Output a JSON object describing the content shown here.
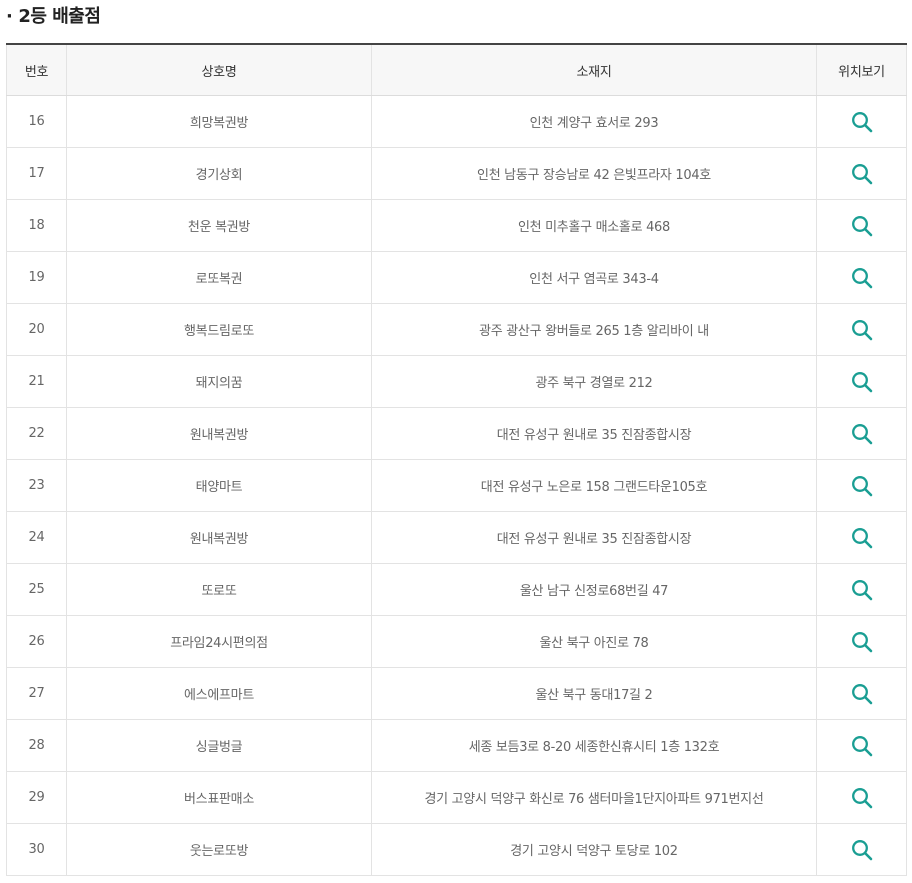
{
  "section": {
    "bullet": "·",
    "title": "2등 배출점"
  },
  "table": {
    "headers": {
      "no": "번호",
      "name": "상호명",
      "address": "소재지",
      "map": "위치보기"
    },
    "rows": [
      {
        "no": "16",
        "name": "희망복권방",
        "address": "인천 계양구 효서로 293"
      },
      {
        "no": "17",
        "name": "경기상회",
        "address": "인천 남동구 장승남로 42 은빛프라자 104호"
      },
      {
        "no": "18",
        "name": "천운 복권방",
        "address": "인천 미추홀구 매소홀로 468"
      },
      {
        "no": "19",
        "name": "로또복권",
        "address": "인천 서구 염곡로 343-4"
      },
      {
        "no": "20",
        "name": "행복드림로또",
        "address": "광주 광산구 왕버들로 265 1층 알리바이 내"
      },
      {
        "no": "21",
        "name": "돼지의꿈",
        "address": "광주 북구 경열로 212"
      },
      {
        "no": "22",
        "name": "원내복권방",
        "address": "대전 유성구 원내로 35 진잠종합시장"
      },
      {
        "no": "23",
        "name": "태양마트",
        "address": "대전 유성구 노은로 158 그랜드타운105호"
      },
      {
        "no": "24",
        "name": "원내복권방",
        "address": "대전 유성구 원내로 35 진잠종합시장"
      },
      {
        "no": "25",
        "name": "또로또",
        "address": "울산 남구 신정로68번길 47"
      },
      {
        "no": "26",
        "name": "프라임24시편의점",
        "address": "울산 북구 아진로 78"
      },
      {
        "no": "27",
        "name": "에스에프마트",
        "address": "울산 북구 동대17길 2"
      },
      {
        "no": "28",
        "name": "싱글벙글",
        "address": "세종 보듬3로 8-20 세종한신휴시티 1층 132호"
      },
      {
        "no": "29",
        "name": "버스표판매소",
        "address": "경기 고양시 덕양구 화신로 76 샘터마을1단지아파트 971번지선"
      },
      {
        "no": "30",
        "name": "웃는로또방",
        "address": "경기 고양시 덕양구 토당로 102"
      }
    ]
  },
  "icons": {
    "map_view": "search-icon"
  },
  "colors": {
    "icon": "#1a9e93",
    "header_bg": "#f7f7f7",
    "header_top_border": "#444444"
  }
}
